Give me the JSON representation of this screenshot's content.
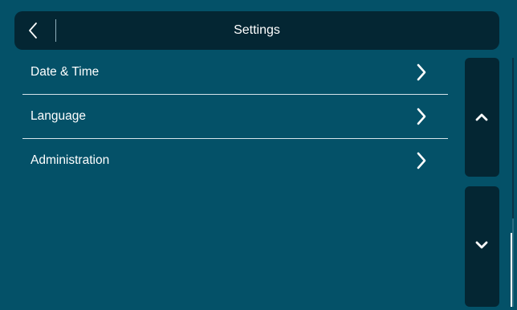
{
  "header": {
    "title": "Settings",
    "back_icon": "chevron-left-icon"
  },
  "menu": {
    "items": [
      {
        "label": "Date & Time",
        "icon": "chevron-right-icon"
      },
      {
        "label": "Language",
        "icon": "chevron-right-icon"
      },
      {
        "label": "Administration",
        "icon": "chevron-right-icon"
      }
    ]
  },
  "scroll": {
    "up_icon": "chevron-up-icon",
    "down_icon": "chevron-down-icon"
  },
  "colors": {
    "background": "#045168",
    "panel": "#042633",
    "text": "#ffffff",
    "divider": "#d7e4ea"
  }
}
